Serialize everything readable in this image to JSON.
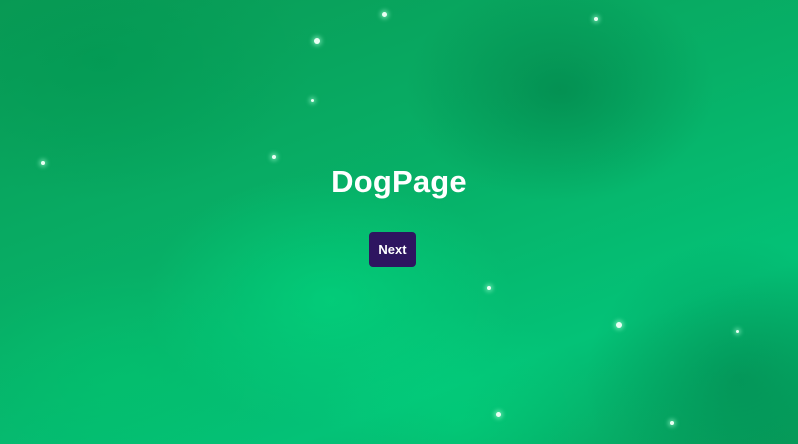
{
  "page": {
    "title": "DogPage",
    "next_button_label": "Next"
  },
  "colors": {
    "background": "#06a763",
    "button_bg": "#2e1560",
    "button_text": "#ffffff",
    "title_text": "#ffffff"
  }
}
